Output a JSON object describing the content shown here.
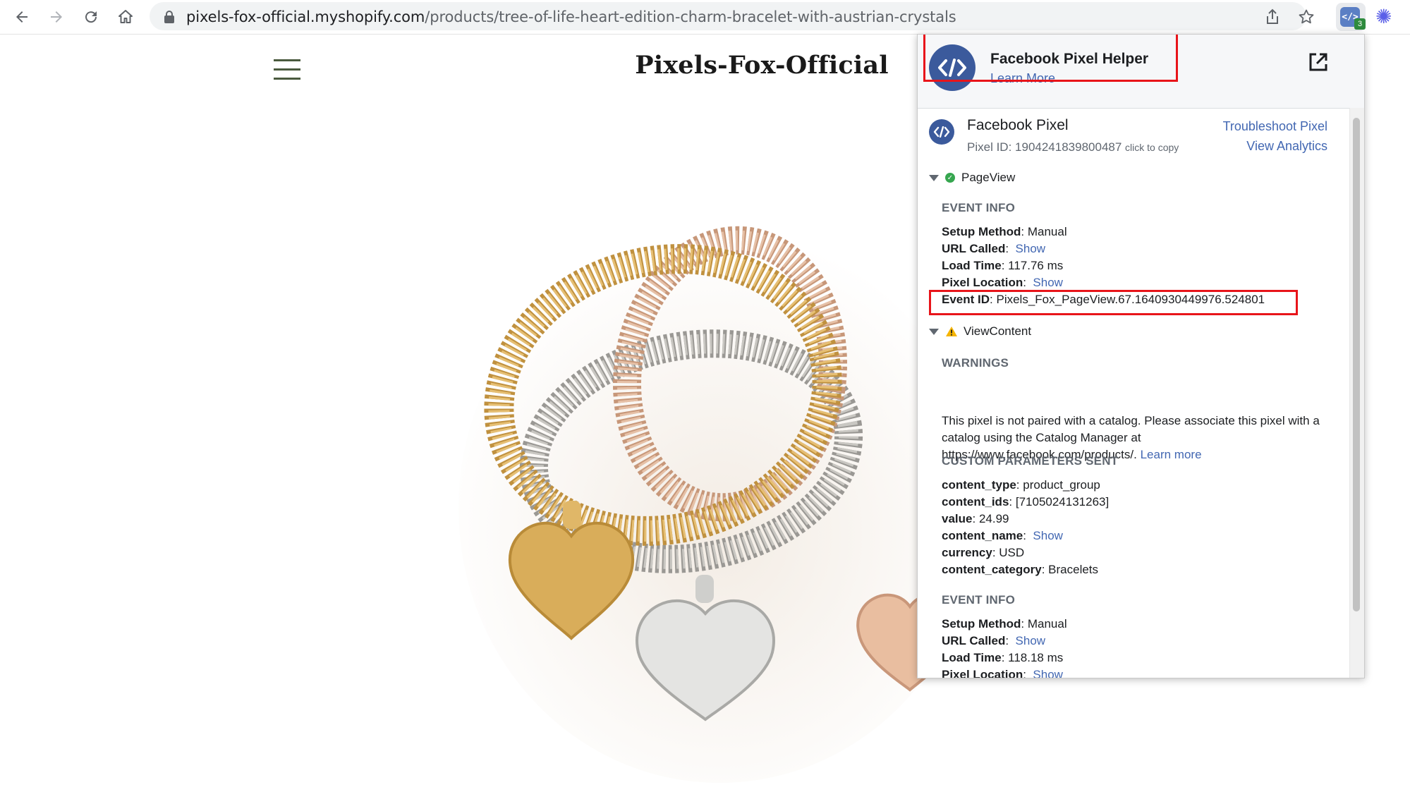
{
  "browser": {
    "url_host": "pixels-fox-official.myshopify.com",
    "url_path": "/products/tree-of-life-heart-edition-charm-bracelet-with-austrian-crystals",
    "extension_badge": "3",
    "extension_label": "</>"
  },
  "store": {
    "title": "Pixels-Fox-Official"
  },
  "helper": {
    "title": "Facebook Pixel Helper",
    "learn_more": "Learn More",
    "pixel_title": "Facebook Pixel",
    "pixel_id_label": "Pixel ID:",
    "pixel_id": "1904241839800487",
    "click_to_copy": "click to copy",
    "troubleshoot": "Troubleshoot Pixel",
    "view_analytics": "View Analytics",
    "events": [
      {
        "name": "PageView",
        "status": "ok",
        "section": "EVENT INFO",
        "rows": [
          {
            "key": "Setup Method",
            "value": "Manual",
            "link": false
          },
          {
            "key": "URL Called",
            "value": "Show",
            "link": true
          },
          {
            "key": "Load Time",
            "value": "117.76 ms",
            "link": false
          },
          {
            "key": "Pixel Location",
            "value": "Show",
            "link": true
          },
          {
            "key": "Event ID",
            "value": "Pixels_Fox_PageView.67.1640930449976.524801",
            "link": false
          }
        ]
      },
      {
        "name": "ViewContent",
        "status": "warning",
        "warnings_heading": "WARNINGS",
        "warning_text": "This pixel is not paired with a catalog. Please associate this pixel with a catalog using the Catalog Manager at https://www.facebook.com/products/.",
        "warning_link": "Learn more",
        "params_heading": "CUSTOM PARAMETERS SENT",
        "params": [
          {
            "key": "content_type",
            "value": "product_group",
            "link": false
          },
          {
            "key": "content_ids",
            "value": "[7105024131263]",
            "link": false
          },
          {
            "key": "value",
            "value": "24.99",
            "link": false
          },
          {
            "key": "content_name",
            "value": "Show",
            "link": true
          },
          {
            "key": "currency",
            "value": "USD",
            "link": false
          },
          {
            "key": "content_category",
            "value": "Bracelets",
            "link": false
          }
        ],
        "section": "EVENT INFO",
        "rows": [
          {
            "key": "Setup Method",
            "value": "Manual",
            "link": false
          },
          {
            "key": "URL Called",
            "value": "Show",
            "link": true
          },
          {
            "key": "Load Time",
            "value": "118.18 ms",
            "link": false
          },
          {
            "key": "Pixel Location",
            "value": "Show",
            "link": true
          }
        ]
      }
    ]
  },
  "colors": {
    "facebook_blue": "#3b5a9c",
    "link_blue": "#4267b2",
    "highlight_red": "#e8141a",
    "ok_green": "#36a64f",
    "warning_yellow": "#f5b400"
  },
  "icons": [
    "back-arrow-icon",
    "forward-arrow-icon",
    "reload-icon",
    "home-icon",
    "lock-icon",
    "share-icon",
    "star-icon",
    "pixel-helper-extension-icon",
    "snowflake-extension-icon",
    "hamburger-menu-icon",
    "open-external-icon",
    "checkmark-icon",
    "warning-icon",
    "caret-down-icon"
  ]
}
